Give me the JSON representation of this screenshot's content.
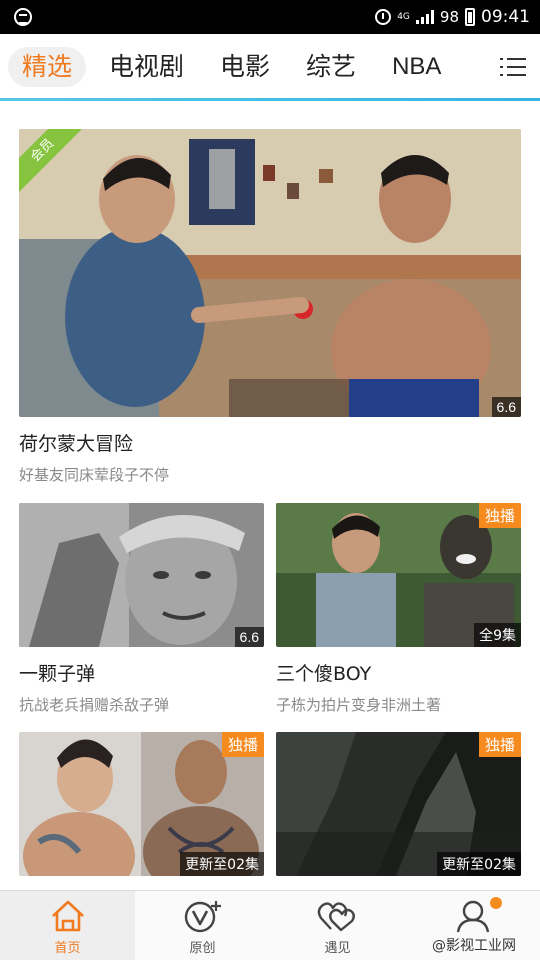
{
  "status_bar": {
    "network": "4G",
    "battery": "98",
    "time": "09:41"
  },
  "top_nav": {
    "tabs": [
      "精选",
      "电视剧",
      "电影",
      "综艺",
      "NBA"
    ]
  },
  "feed": {
    "featured": {
      "ribbon": "会员",
      "rating": "6.6",
      "title": "荷尔蒙大冒险",
      "subtitle": "好基友同床荤段子不停"
    },
    "cards": [
      {
        "title": "一颗子弹",
        "subtitle": "抗战老兵捐赠杀敌子弹",
        "badge_bottom": "6.6",
        "badge_top": ""
      },
      {
        "title": "三个傻BOY",
        "subtitle": "子栋为拍片变身非洲土著",
        "badge_bottom": "全9集",
        "badge_top": "独播"
      },
      {
        "title": "",
        "subtitle": "",
        "badge_bottom": "更新至02集",
        "badge_top": "独播"
      },
      {
        "title": "",
        "subtitle": "",
        "badge_bottom": "更新至02集",
        "badge_top": "独播"
      }
    ]
  },
  "bottom_nav": {
    "items": [
      "首页",
      "原创",
      "遇见",
      ""
    ],
    "watermark": "@影视工业网"
  },
  "colors": {
    "accent": "#f07b21",
    "badge_orange": "#f58a1f",
    "member_green": "#86c440",
    "divider_blue": "#3cb9e3"
  }
}
